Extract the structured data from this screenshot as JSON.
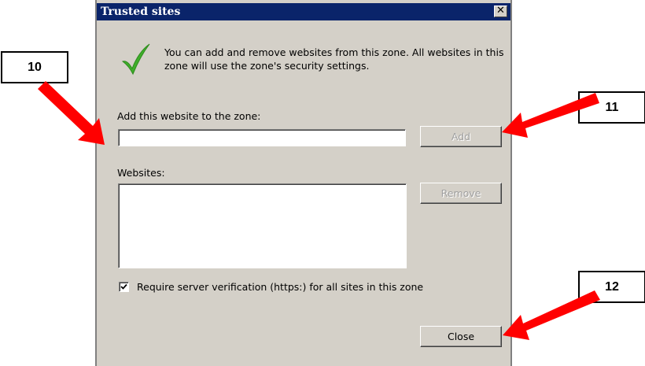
{
  "dialog": {
    "title": "Trusted sites",
    "close_glyph": "✕",
    "intro_text": "You can add and remove websites from this zone. All websites in this zone will use the zone's security settings.",
    "add_label": "Add this website to the zone:",
    "add_input_value": "",
    "add_button": "Add",
    "websites_label": "Websites:",
    "websites": [],
    "remove_button": "Remove",
    "verify_label": "Require server verification (https:) for all sites in this zone",
    "verify_checked": true,
    "close_button": "Close",
    "icon": "checkmark-icon"
  },
  "callouts": [
    {
      "label": "10"
    },
    {
      "label": "11"
    },
    {
      "label": "12"
    }
  ],
  "colors": {
    "titlebar": "#0a246a",
    "dialog_bg": "#d4d0c8",
    "arrow": "#ff0000",
    "check_green": "#3fae2a"
  }
}
